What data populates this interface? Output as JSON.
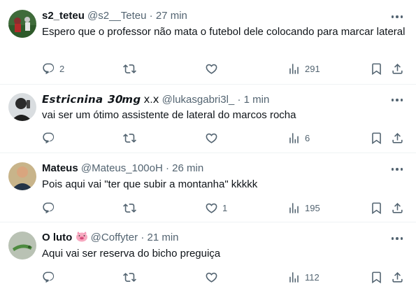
{
  "tweets": [
    {
      "name": "s2_teteu",
      "handle": "@s2__Teteu",
      "sep": "·",
      "time": "27 min",
      "text": "Espero que o professor não mata o futebol dele colocando para marcar lateral",
      "replies": "2",
      "retweets": "",
      "likes": "",
      "views": "291"
    },
    {
      "name": "𝙀𝙨𝙩𝙧𝙞𝙘𝙣𝙞𝙣𝙖 𝟯𝟬𝙢𝙜",
      "badge": "ⅹ.ⅹ",
      "handle": "@lukasgabri3l_",
      "sep": "·",
      "time": "1 min",
      "text": "vai ser um ótimo assistente de lateral do marcos rocha",
      "replies": "",
      "retweets": "",
      "likes": "",
      "views": "6"
    },
    {
      "name": "Mateus",
      "handle": "@Mateus_100oH",
      "sep": "·",
      "time": "26 min",
      "text": "Pois aqui vai \"ter que subir a montanha\" kkkkk",
      "replies": "",
      "retweets": "",
      "likes": "1",
      "views": "195"
    },
    {
      "name": "O luto",
      "handle": "@Coffyter",
      "sep": "·",
      "time": "21 min",
      "text": "Aqui vai ser reserva do bicho preguiça",
      "replies": "",
      "retweets": "",
      "likes": "",
      "views": "112"
    }
  ],
  "icons": {
    "reply": "reply-icon",
    "retweet": "retweet-icon",
    "like": "heart-icon",
    "views": "views-icon",
    "bookmark": "bookmark-icon",
    "share": "share-icon",
    "more": "more-icon",
    "pig": "pig-emoji-icon"
  },
  "colors": {
    "text": "#0f1419",
    "secondary": "#536471",
    "border": "#eff3f4"
  }
}
